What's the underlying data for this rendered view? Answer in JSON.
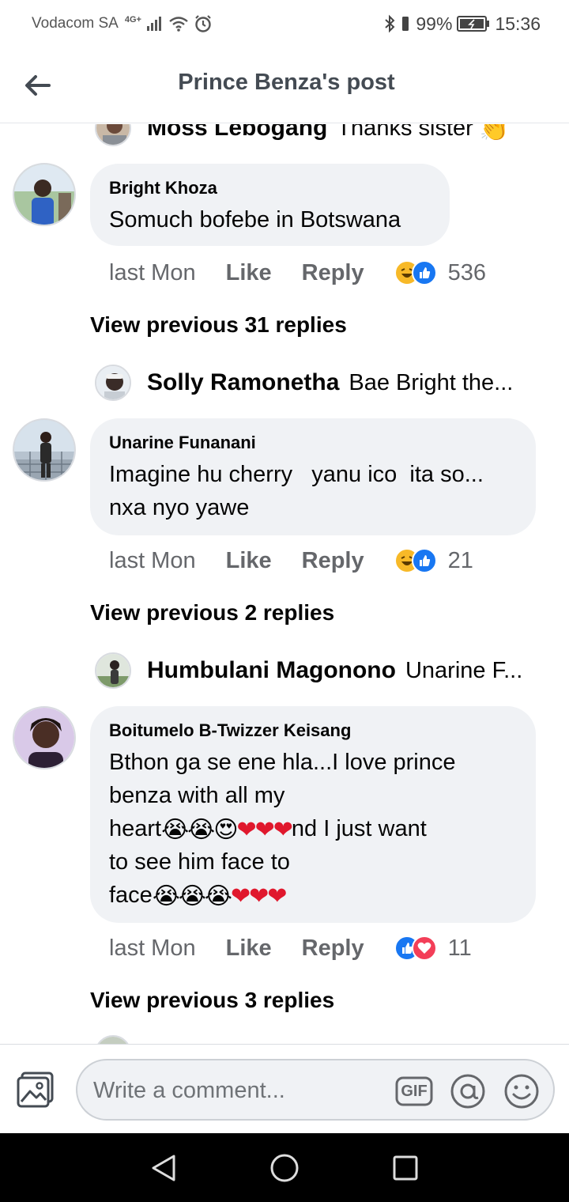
{
  "status_bar": {
    "carrier": "Vodacom SA",
    "network": "4G+",
    "battery": "99%",
    "time": "15:36"
  },
  "header": {
    "title": "Prince Benza's post"
  },
  "comments": [
    {
      "top_reply": {
        "name": "Moss Lebogang",
        "text": "Thanks sister"
      },
      "name": "Bright Khoza",
      "text": "Somuch bofebe in Botswana",
      "time": "last Mon",
      "like_label": "Like",
      "reply_label": "Reply",
      "reactions": [
        "haha",
        "like"
      ],
      "reaction_count": "536",
      "view_previous": "View previous 31 replies",
      "latest_reply": {
        "name": "Solly Ramonetha",
        "text": "Bae Bright the..."
      }
    },
    {
      "name": "Unarine Funanani",
      "text_lines": [
        "Imagine hu cherry   yanu ico  ita so...",
        "nxa nyo yawe"
      ],
      "time": "last Mon",
      "like_label": "Like",
      "reply_label": "Reply",
      "reactions": [
        "haha",
        "like"
      ],
      "reaction_count": "21",
      "view_previous": "View previous 2 replies",
      "latest_reply": {
        "name": "Humbulani Magonono",
        "text": "Unarine F..."
      }
    },
    {
      "name": "Boitumelo B-Twizzer Keisang",
      "text_parts": {
        "line1": "Bthon ga se ene hla...I love prince",
        "line2": "benza with all my",
        "line3_a": "heart",
        "line3_emojis": "😭😭😍",
        "line3_hearts": "❤❤❤",
        "line3_b": "nd I just want",
        "line4": "to see him face to",
        "line5_a": "face",
        "line5_emojis": "😭😭😭",
        "line5_hearts": "❤❤❤"
      },
      "time": "last Mon",
      "like_label": "Like",
      "reply_label": "Reply",
      "reactions": [
        "like",
        "love"
      ],
      "reaction_count": "11",
      "view_previous": "View previous 3 replies"
    }
  ],
  "composer": {
    "placeholder": "Write a comment...",
    "gif_label": "GIF"
  },
  "icons": {
    "back": "arrow-left-icon",
    "photo": "photo-icon",
    "mention": "at-sign-icon",
    "emoji": "smiley-icon"
  },
  "colors": {
    "like_blue": "#1877f2",
    "haha_yellow": "#f7b928",
    "love_red": "#f33e58",
    "bubble_bg": "#f0f2f5",
    "meta_gray": "#65676b"
  }
}
